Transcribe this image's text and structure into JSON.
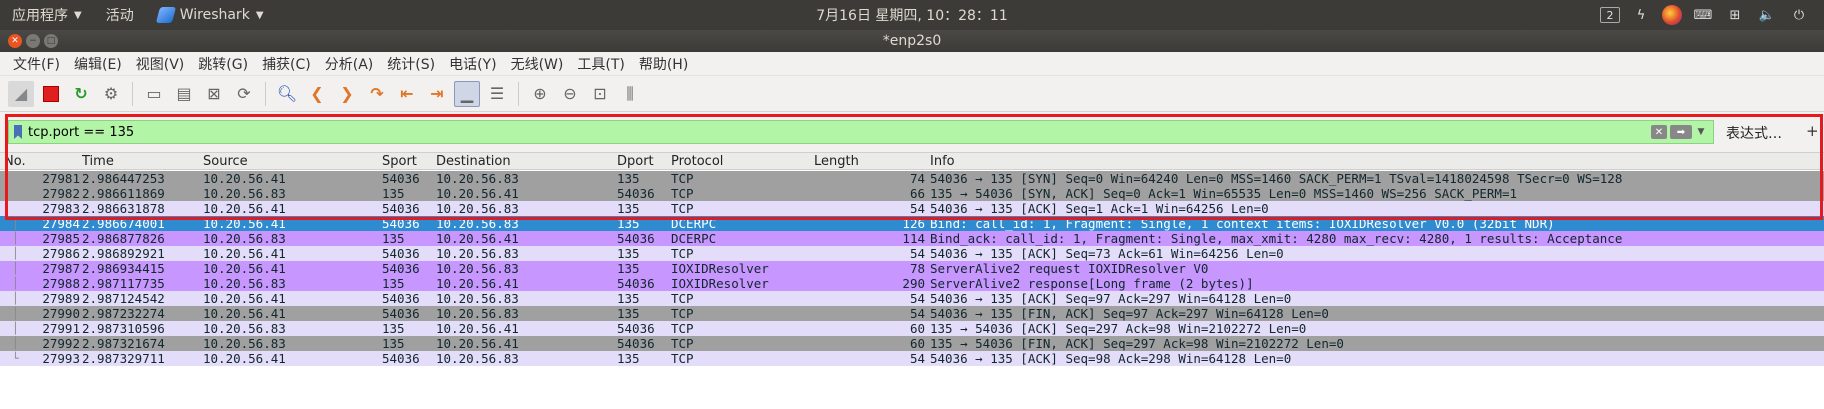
{
  "topbar": {
    "apps_menu": "应用程序",
    "activities": "活动",
    "app_name": "Wireshark",
    "clock": "7月16日 星期四, 10：28：11",
    "workspace": "2"
  },
  "window": {
    "title": "*enp2s0"
  },
  "menubar": [
    "文件(F)",
    "编辑(E)",
    "视图(V)",
    "跳转(G)",
    "捕获(C)",
    "分析(A)",
    "统计(S)",
    "电话(Y)",
    "无线(W)",
    "工具(T)",
    "帮助(H)"
  ],
  "filter": {
    "text": "tcp.port == 135",
    "expression_button": "表达式…",
    "add_button": "+"
  },
  "columns": {
    "no": "No.",
    "time": "Time",
    "source": "Source",
    "sport": "Sport",
    "destination": "Destination",
    "dport": "Dport",
    "protocol": "Protocol",
    "length": "Length",
    "info": "Info"
  },
  "packets": [
    {
      "no": "27981",
      "time": "2.986447253",
      "src": "10.20.56.41",
      "sport": "54036",
      "dst": "10.20.56.83",
      "dport": "135",
      "proto": "TCP",
      "len": "74",
      "info": "54036 → 135 [SYN] Seq=0 Win=64240 Len=0 MSS=1460 SACK_PERM=1 TSval=1418024598 TSecr=0 WS=128",
      "color": "gray"
    },
    {
      "no": "27982",
      "time": "2.986611869",
      "src": "10.20.56.83",
      "sport": "135",
      "dst": "10.20.56.41",
      "dport": "54036",
      "proto": "TCP",
      "len": "66",
      "info": "135 → 54036 [SYN, ACK] Seq=0 Ack=1 Win=65535 Len=0 MSS=1460 WS=256 SACK_PERM=1",
      "color": "gray"
    },
    {
      "no": "27983",
      "time": "2.986631878",
      "src": "10.20.56.41",
      "sport": "54036",
      "dst": "10.20.56.83",
      "dport": "135",
      "proto": "TCP",
      "len": "54",
      "info": "54036 → 135 [ACK] Seq=1 Ack=1 Win=64256 Len=0",
      "color": "lavender"
    },
    {
      "no": "27984",
      "time": "2.986674001",
      "src": "10.20.56.41",
      "sport": "54036",
      "dst": "10.20.56.83",
      "dport": "135",
      "proto": "DCERPC",
      "len": "126",
      "info": "Bind: call_id: 1, Fragment: Single, 1 context items: IOXIDResolver V0.0 (32bit NDR)",
      "color": "blue"
    },
    {
      "no": "27985",
      "time": "2.986877826",
      "src": "10.20.56.83",
      "sport": "135",
      "dst": "10.20.56.41",
      "dport": "54036",
      "proto": "DCERPC",
      "len": "114",
      "info": "Bind_ack: call_id: 1, Fragment: Single, max_xmit: 4280 max_recv: 4280, 1 results: Acceptance",
      "color": "purple"
    },
    {
      "no": "27986",
      "time": "2.986892921",
      "src": "10.20.56.41",
      "sport": "54036",
      "dst": "10.20.56.83",
      "dport": "135",
      "proto": "TCP",
      "len": "54",
      "info": "54036 → 135 [ACK] Seq=73 Ack=61 Win=64256 Len=0",
      "color": "lavender"
    },
    {
      "no": "27987",
      "time": "2.986934415",
      "src": "10.20.56.41",
      "sport": "54036",
      "dst": "10.20.56.83",
      "dport": "135",
      "proto": "IOXIDResolver",
      "len": "78",
      "info": "ServerAlive2 request IOXIDResolver V0",
      "color": "purple"
    },
    {
      "no": "27988",
      "time": "2.987117735",
      "src": "10.20.56.83",
      "sport": "135",
      "dst": "10.20.56.41",
      "dport": "54036",
      "proto": "IOXIDResolver",
      "len": "290",
      "info": "ServerAlive2 response[Long frame (2 bytes)]",
      "color": "purple"
    },
    {
      "no": "27989",
      "time": "2.987124542",
      "src": "10.20.56.41",
      "sport": "54036",
      "dst": "10.20.56.83",
      "dport": "135",
      "proto": "TCP",
      "len": "54",
      "info": "54036 → 135 [ACK] Seq=97 Ack=297 Win=64128 Len=0",
      "color": "lavender"
    },
    {
      "no": "27990",
      "time": "2.987232274",
      "src": "10.20.56.41",
      "sport": "54036",
      "dst": "10.20.56.83",
      "dport": "135",
      "proto": "TCP",
      "len": "54",
      "info": "54036 → 135 [FIN, ACK] Seq=97 Ack=297 Win=64128 Len=0",
      "color": "gray"
    },
    {
      "no": "27991",
      "time": "2.987310596",
      "src": "10.20.56.83",
      "sport": "135",
      "dst": "10.20.56.41",
      "dport": "54036",
      "proto": "TCP",
      "len": "60",
      "info": "135 → 54036 [ACK] Seq=297 Ack=98 Win=2102272 Len=0",
      "color": "lavender"
    },
    {
      "no": "27992",
      "time": "2.987321674",
      "src": "10.20.56.83",
      "sport": "135",
      "dst": "10.20.56.41",
      "dport": "54036",
      "proto": "TCP",
      "len": "60",
      "info": "135 → 54036 [FIN, ACK] Seq=297 Ack=98 Win=2102272 Len=0",
      "color": "gray"
    },
    {
      "no": "27993",
      "time": "2.987329711",
      "src": "10.20.56.41",
      "sport": "54036",
      "dst": "10.20.56.83",
      "dport": "135",
      "proto": "TCP",
      "len": "54",
      "info": "54036 → 135 [ACK] Seq=98 Ack=298 Win=64128 Len=0",
      "color": "lavender"
    }
  ],
  "colors": {
    "gray": "#a0a0a0",
    "lavender": "#e4ddf9",
    "purple": "#c797ff",
    "blue": "#2f8bd0",
    "filter_valid": "#b3f5a6",
    "highlight_frame": "#e8191d"
  }
}
